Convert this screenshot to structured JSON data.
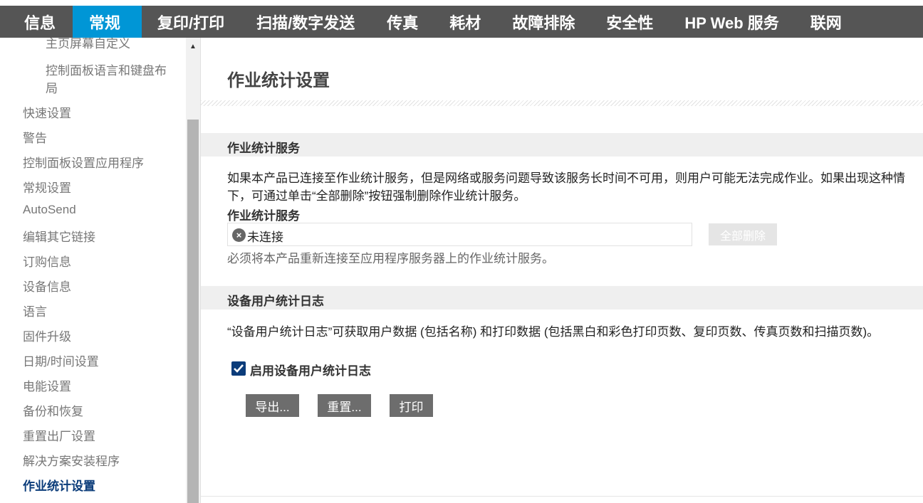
{
  "nav": {
    "tabs": [
      {
        "label": "信息"
      },
      {
        "label": "常规"
      },
      {
        "label": "复印/打印"
      },
      {
        "label": "扫描/数字发送"
      },
      {
        "label": "传真"
      },
      {
        "label": "耗材"
      },
      {
        "label": "故障排除"
      },
      {
        "label": "安全性"
      },
      {
        "label": "HP Web 服务"
      },
      {
        "label": "联网"
      }
    ],
    "active_tab": "常规"
  },
  "sidebar": {
    "items": [
      {
        "label": "主页屏幕自定义"
      },
      {
        "label": "控制面板语言和键盘布"
      },
      {
        "label": "局"
      },
      {
        "label": "快速设置"
      },
      {
        "label": "警告"
      },
      {
        "label": "控制面板设置应用程序"
      },
      {
        "label": "常规设置"
      },
      {
        "label": "AutoSend"
      },
      {
        "label": "编辑其它链接"
      },
      {
        "label": "订购信息"
      },
      {
        "label": "设备信息"
      },
      {
        "label": "语言"
      },
      {
        "label": "固件升级"
      },
      {
        "label": "日期/时间设置"
      },
      {
        "label": "电能设置"
      },
      {
        "label": "备份和恢复"
      },
      {
        "label": "重置出厂设置"
      },
      {
        "label": "解决方案安装程序"
      },
      {
        "label": "作业统计设置"
      }
    ],
    "active_item": "作业统计设置"
  },
  "main": {
    "title": "作业统计设置",
    "service_section": {
      "header": "作业统计服务",
      "description_line1": "如果本产品已连接至作业统计服务，但是网络或服务问题导致该服务长时间不可用，则用户可能无法完成作业。如果出现这种情",
      "description_line2": "下，可通过单击“全部删除”按钮强制删除作业统计服务。",
      "field_label": "作业统计服务",
      "status_value": "未连接",
      "delete_all_label": "全部删除",
      "hint": "必须将本产品重新连接至应用程序服务器上的作业统计服务。"
    },
    "log_section": {
      "header": "设备用户统计日志",
      "description": "“设备用户统计日志”可获取用户数据 (包括名称) 和打印数据 (包括黑白和彩色打印页数、复印页数、传真页数和扫描页数)。",
      "enable_label": "启用设备用户统计日志",
      "enable_checked": true,
      "export_label": "导出...",
      "reset_label": "重置...",
      "print_label": "打印"
    }
  },
  "colors": {
    "nav_bg": "#555555",
    "nav_active": "#0096d6",
    "sidebar_active": "#0b3c7a",
    "button_bg": "#6d6d6d"
  }
}
